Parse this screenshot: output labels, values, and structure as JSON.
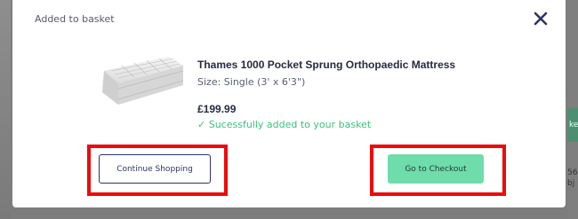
{
  "modal": {
    "title": "Added to basket",
    "close_icon": "close-icon"
  },
  "product": {
    "name": "Thames 1000 Pocket Sprung Orthopaedic Mattress",
    "size": "Size: Single (3' x 6'3\")",
    "price": "£199.99",
    "success_message": "✓ Sucessfully added to your basket",
    "image_icon": "mattress-image"
  },
  "actions": {
    "continue_label": "Continue Shopping",
    "checkout_label": "Go to Checkout"
  },
  "background": {
    "button_fragment": "ke",
    "text_fragment_1": "56",
    "text_fragment_2": "bj"
  },
  "colors": {
    "success": "#3cbf7e",
    "checkout_bg": "#6fdcab",
    "continue_border": "#2c3366",
    "highlight": "#ee0a0a",
    "title_text": "#262b3e"
  }
}
